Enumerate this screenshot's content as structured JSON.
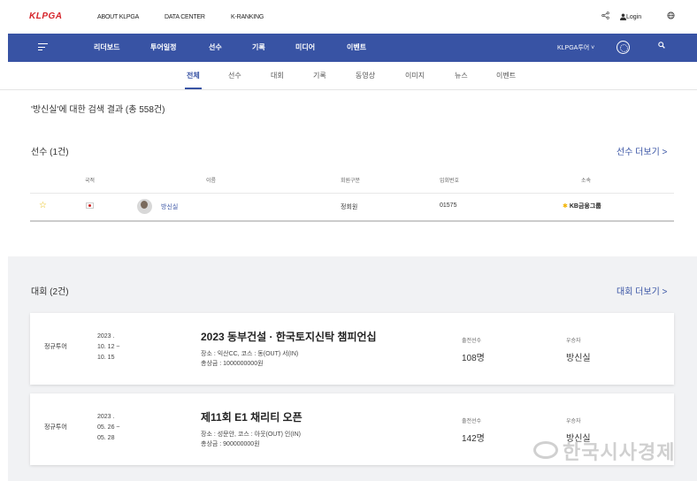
{
  "header": {
    "logo": "KLPGA",
    "links": [
      "ABOUT KLPGA",
      "DATA CENTER",
      "K-RANKING"
    ],
    "login": "Login"
  },
  "nav": {
    "items": [
      "리더보드",
      "투어일정",
      "선수",
      "기록",
      "미디어",
      "이벤트"
    ],
    "tour_menu": "KLPGA투어 ˅"
  },
  "subnav": {
    "items": [
      "전체",
      "선수",
      "대회",
      "기록",
      "동영상",
      "이미지",
      "뉴스",
      "이벤트"
    ]
  },
  "result_title": "'방신실'에 대한 검색 결과 (총 558건)",
  "players": {
    "title": "선수 (1건)",
    "more": "선수 더보기 >",
    "columns": [
      "국적",
      "이름",
      "회원구분",
      "입회번호",
      "소속"
    ],
    "rows": [
      {
        "name": "방신실",
        "member_type": "정회원",
        "member_no": "01575",
        "affiliation": "KB금융그룹"
      }
    ]
  },
  "tournaments": {
    "title": "대회 (2건)",
    "more": "대회 더보기 >",
    "items": [
      {
        "type": "정규투어",
        "date_line1": "2023 .",
        "date_line2": "10. 12 ~",
        "date_line3": "10. 15",
        "name": "2023 동부건설 · 한국토지신탁 챔피언십",
        "venue": "장소 : 익산CC, 코스 : 동(OUT) 서(IN)",
        "prize": "총상금 : 1000000000원",
        "entrants_label": "출전선수",
        "entrants": "108명",
        "winner_label": "우승자",
        "winner": "방신실"
      },
      {
        "type": "정규투어",
        "date_line1": "2023 .",
        "date_line2": "05. 26 ~",
        "date_line3": "05. 28",
        "name": "제11회 E1 채리티 오픈",
        "venue": "장소 : 성문안, 코스 : 아웃(OUT) 인(IN)",
        "prize": "총상금 : 900000000원",
        "entrants_label": "출전선수",
        "entrants": "142명",
        "winner_label": "우승자",
        "winner": "방신실"
      }
    ]
  },
  "watermark": "한국시사경제",
  "icons": [
    "share-icon",
    "user-icon",
    "globe-icon",
    "menu-icon",
    "search-icon",
    "star-icon",
    "flag-icon",
    "kb-logo-icon"
  ],
  "colors": {
    "brand": "#3853a4",
    "logo_red": "#d6242b",
    "star": "#e6b800"
  }
}
